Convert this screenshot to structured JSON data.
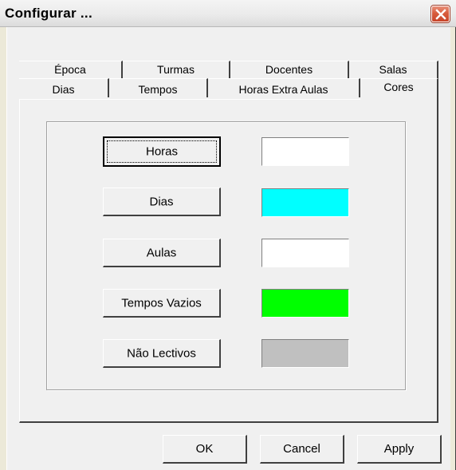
{
  "window": {
    "title": "Configurar ..."
  },
  "tabs": {
    "row1": [
      {
        "label": "Época"
      },
      {
        "label": "Turmas"
      },
      {
        "label": "Docentes"
      },
      {
        "label": "Salas"
      }
    ],
    "row2": [
      {
        "label": "Dias"
      },
      {
        "label": "Tempos"
      },
      {
        "label": "Horas Extra Aulas"
      },
      {
        "label": "Cores"
      }
    ],
    "active": "Cores"
  },
  "colors_panel": {
    "items": [
      {
        "label": "Horas",
        "color": "#ffffff"
      },
      {
        "label": "Dias",
        "color": "#00ffff"
      },
      {
        "label": "Aulas",
        "color": "#ffffff"
      },
      {
        "label": "Tempos Vazios",
        "color": "#00ff00"
      },
      {
        "label": "Não Lectivos",
        "color": "#c0c0c0"
      }
    ]
  },
  "footer": {
    "ok_label": "OK",
    "cancel_label": "Cancel",
    "apply_label": "Apply"
  }
}
